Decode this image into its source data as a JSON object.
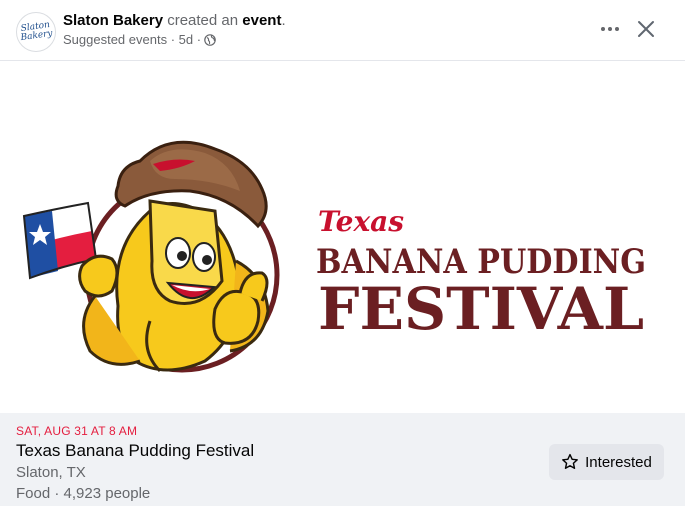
{
  "post": {
    "author": "Slaton Bakery",
    "verb": " created an ",
    "object": "event",
    "period": ".",
    "meta": "Suggested events · 5d ·",
    "avatar_text_line1": "Slaton",
    "avatar_text_line2": "Bakery",
    "more_icon": "more-horizontal-icon",
    "close_icon": "close-icon",
    "globe_icon": "globe-icon"
  },
  "image": {
    "logo_small": "Texas",
    "logo_line1": "BANANA PUDDING",
    "logo_line2": "FESTIVAL"
  },
  "event": {
    "date": "SAT, AUG 31 AT 8 AM",
    "title": "Texas Banana Pudding Festival",
    "location": "Slaton, TX",
    "category": "Food · 4,923 people",
    "interested_label": "Interested",
    "star_icon": "star-icon"
  },
  "colors": {
    "date_red": "#e41e3f",
    "logo_maroon": "#6b1f22",
    "logo_red": "#c8102e",
    "banana_yellow": "#f7c91c",
    "hat_brown": "#8a5a3b",
    "footer_bg": "#f0f2f5"
  }
}
